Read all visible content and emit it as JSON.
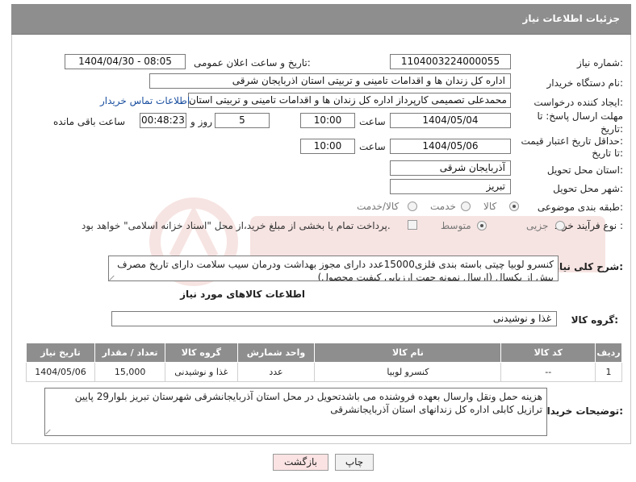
{
  "header": {
    "title": "جزئیات اطلاعات نیاز"
  },
  "fields": {
    "need_number": {
      "label": "شماره نیاز:",
      "value": "1104003224000055"
    },
    "announce_date": {
      "label": "تاریخ و ساعت اعلان عمومی:",
      "value": "1404/04/30 - 08:05"
    },
    "buyer_org": {
      "label": "نام دستگاه خریدار:",
      "value": "اداره کل زندان ها و اقدامات تامینی و تربیتی استان اذربایجان شرقی"
    },
    "requester": {
      "label": "ایجاد کننده درخواست:",
      "value": "محمدعلی تصمیمی کارپرداز اداره کل زندان ها و اقدامات تامینی و تربیتی استان",
      "contact_link": "اطلاعات تماس خریدار"
    },
    "reply_deadline": {
      "label_line1": "مهلت ارسال پاسخ: تا",
      "label_line2": "تاریخ:",
      "date": "1404/05/04",
      "time_label": "ساعت",
      "time": "10:00",
      "days": "5",
      "days_label": "روز و",
      "remaining": "00:48:23",
      "remaining_label": "ساعت باقی مانده"
    },
    "price_validity": {
      "label_line1": "حداقل تاریخ اعتبار قیمت:",
      "label_line2": "تا تاریخ:",
      "date": "1404/05/06",
      "time_label": "ساعت",
      "time": "10:00"
    },
    "delivery_province": {
      "label": "استان محل تحویل:",
      "value": "آذربایجان شرقی"
    },
    "delivery_city": {
      "label": "شهر محل تحویل:",
      "value": "تبریز"
    },
    "category": {
      "label": "طبقه بندی موضوعی:",
      "options": [
        "کالا",
        "خدمت",
        "کالا/خدمت"
      ],
      "selected": "کالا"
    },
    "process_type": {
      "label": "نوع فرآیند خرید :",
      "options": [
        "جزیی",
        "متوسط"
      ],
      "selected": "متوسط",
      "payment_note": "پرداخت تمام یا بخشی از مبلغ خرید،از محل \"اسناد خزانه اسلامی\" خواهد بود."
    }
  },
  "description": {
    "label": "شرح کلی نیاز:",
    "text": "کنسرو لوبیا چیتی باسته بندی فلزی15000عدد دارای مجوز بهداشت ودرمان سیب سلامت دارای تاریخ مصرف بیش از یکسال (ارسال نمونه  جهت ارزیابی کیفیت محصول)"
  },
  "goods_info": {
    "title": "اطلاعات کالاهای مورد نیاز",
    "group_label": "گروه کالا:",
    "group_value": "غذا و نوشیدنی"
  },
  "table": {
    "headers": [
      "ردیف",
      "کد کالا",
      "نام کالا",
      "واحد شمارش",
      "گروه کالا",
      "تعداد / مقدار",
      "تاریخ نیاز"
    ],
    "rows": [
      [
        "1",
        "--",
        "کنسرو لوبیا",
        "عدد",
        "غذا و نوشیدنی",
        "15,000",
        "1404/05/06"
      ]
    ]
  },
  "buyer_notes": {
    "label": "توضیحات خریدار:",
    "text": "هزینه حمل ونقل وارسال بعهده فروشنده می باشدتحویل در محل استان آذربایجانشرقی شهرستان تبریز بلوار29 پایین ترازیل کابلی اداره کل زندانهای استان آذربایجانشرقی"
  },
  "buttons": {
    "print": "چاپ",
    "back": "بازگشت"
  },
  "colors": {
    "header_bg": "#8e8e8e",
    "link": "#1a4fa0",
    "back_button_bg": "#fbe3e3"
  }
}
